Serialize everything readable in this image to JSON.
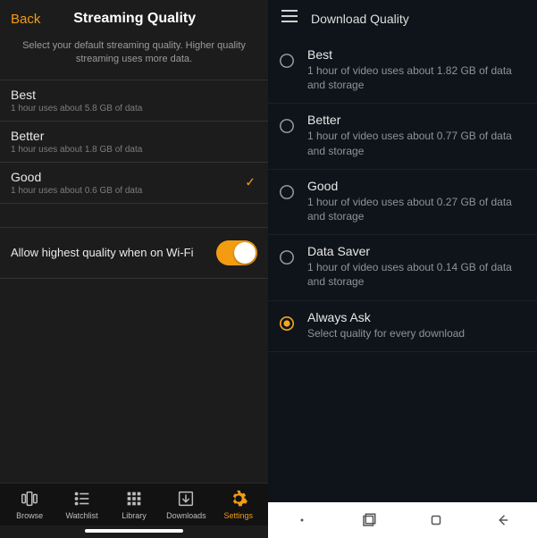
{
  "left": {
    "header": {
      "back": "Back",
      "title": "Streaming Quality"
    },
    "description": "Select your default streaming quality. Higher quality streaming uses more data.",
    "options": [
      {
        "name": "Best",
        "sub": "1 hour uses about 5.8 GB of data"
      },
      {
        "name": "Better",
        "sub": "1 hour uses about 1.8 GB of data"
      },
      {
        "name": "Good",
        "sub": "1 hour uses about 0.6 GB of data"
      }
    ],
    "selected_index": 2,
    "wifi_toggle": {
      "label": "Allow highest quality when on Wi-Fi",
      "on": true
    },
    "tabs": [
      {
        "label": "Browse"
      },
      {
        "label": "Watchlist"
      },
      {
        "label": "Library"
      },
      {
        "label": "Downloads"
      },
      {
        "label": "Settings"
      }
    ],
    "active_tab_index": 4
  },
  "right": {
    "appbar": {
      "title": "Download Quality"
    },
    "options": [
      {
        "name": "Best",
        "sub": "1 hour of video uses about 1.82 GB of data and storage"
      },
      {
        "name": "Better",
        "sub": "1 hour of video uses about 0.77 GB of data and storage"
      },
      {
        "name": "Good",
        "sub": "1 hour of video uses about 0.27 GB of data and storage"
      },
      {
        "name": "Data Saver",
        "sub": "1 hour of video uses about 0.14 GB of data and storage"
      },
      {
        "name": "Always Ask",
        "sub": "Select quality for every download"
      }
    ],
    "selected_index": 4
  },
  "colors": {
    "accent_ios": "#f39c12",
    "accent_and": "#f5a623"
  }
}
